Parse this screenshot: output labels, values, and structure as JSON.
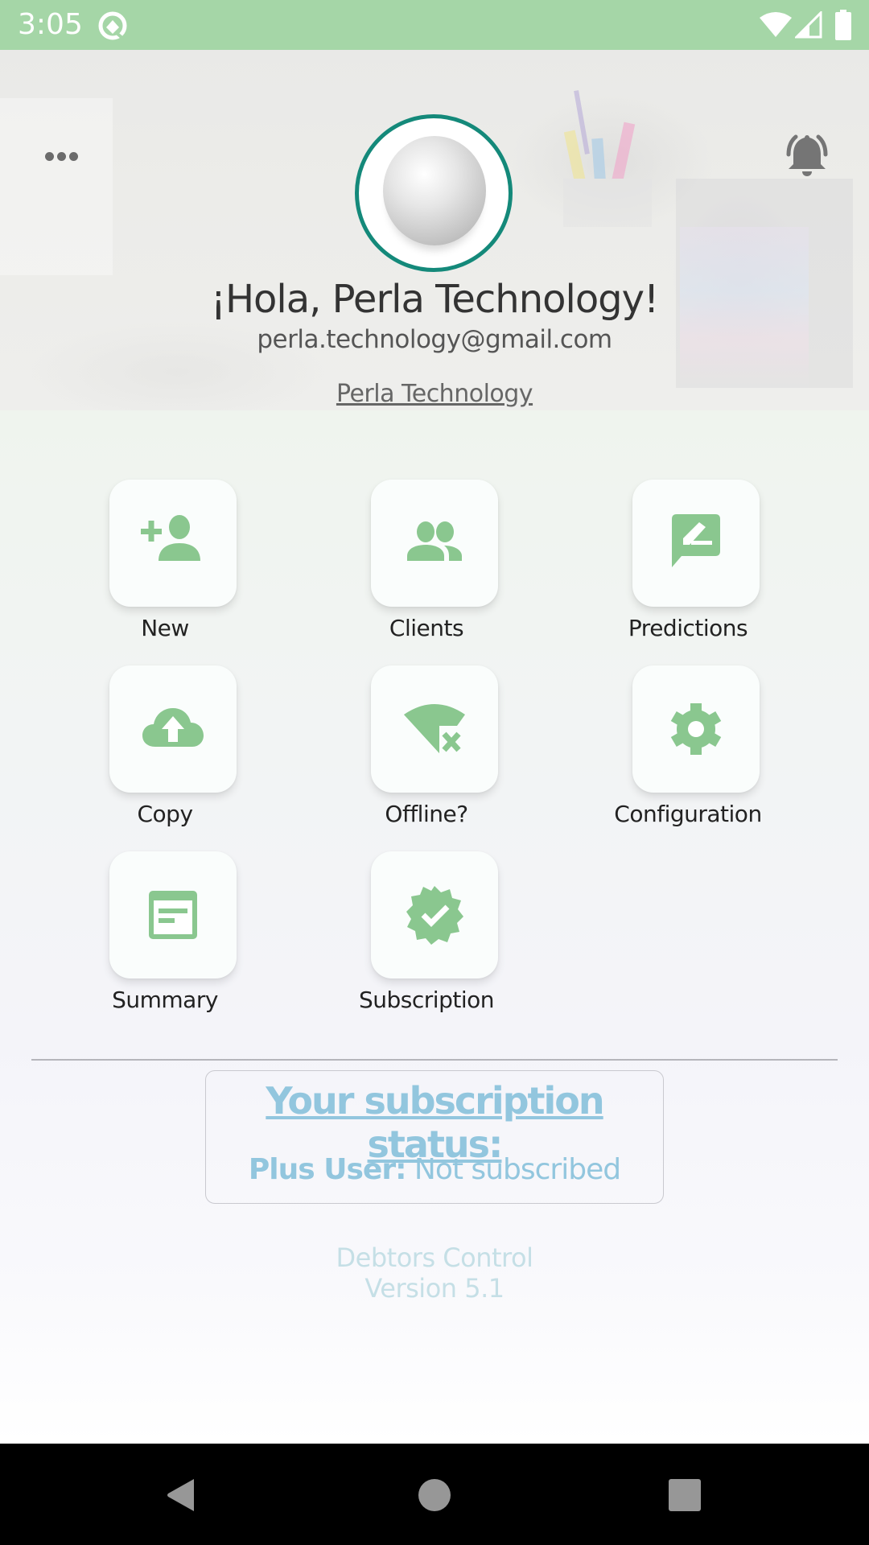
{
  "status_bar": {
    "time": "3:05",
    "icons": [
      "app-notification-icon",
      "wifi-icon",
      "cell-signal-icon",
      "battery-icon"
    ]
  },
  "header": {
    "menu_icon": "more-horizontal-icon",
    "notification_icon": "bell-ringing-icon",
    "avatar_icon": "pearl-avatar",
    "greeting": "¡Hola, Perla Technology!",
    "email": "perla.technology@gmail.com",
    "company_link": "Perla Technology"
  },
  "menu": {
    "items": [
      {
        "label": "New",
        "icon": "person-add-icon"
      },
      {
        "label": "Clients",
        "icon": "people-icon"
      },
      {
        "label": "Predictions",
        "icon": "rate-review-icon"
      },
      {
        "label": "Copy",
        "icon": "cloud-upload-icon"
      },
      {
        "label": "Offline?",
        "icon": "wifi-off-icon"
      },
      {
        "label": "Configuration",
        "icon": "settings-gear-icon"
      },
      {
        "label": "Summary",
        "icon": "summary-document-icon"
      },
      {
        "label": "Subscription",
        "icon": "verified-badge-icon"
      }
    ]
  },
  "subscription": {
    "title": "Your subscription status:",
    "plan_label": "Plus User:",
    "plan_value": "Not subscribed"
  },
  "footer": {
    "app_name": "Debtors Control",
    "version": "Version 5.1"
  },
  "colors": {
    "status_bar": "#a5d6a7",
    "icon_green": "#8ac78f",
    "avatar_ring": "#14897a",
    "subscription_text": "#92c6de",
    "footer_text": "#c5dfe6"
  },
  "nav_bar": {
    "buttons": [
      "back-icon",
      "home-icon",
      "recents-icon"
    ]
  }
}
